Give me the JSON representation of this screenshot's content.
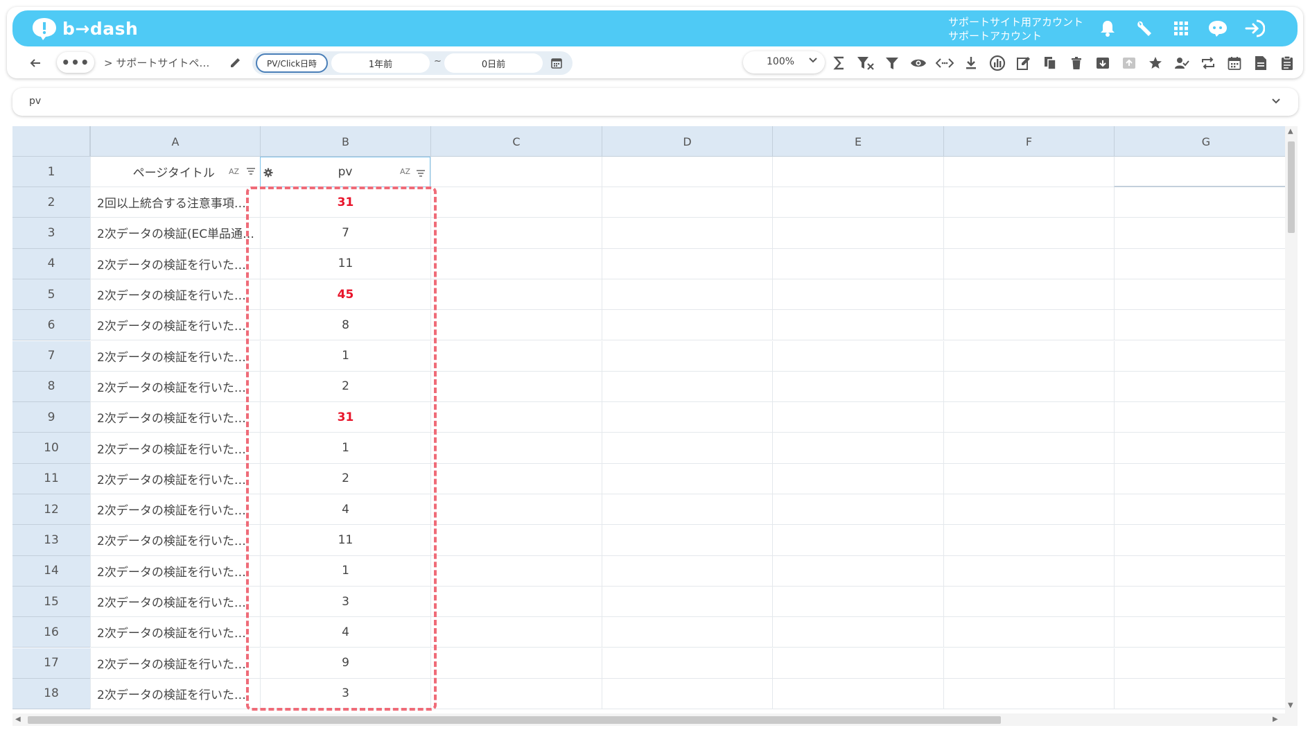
{
  "app": {
    "logo_text": "b→dash",
    "account_line1": "サポートサイト用アカウント",
    "account_line2": "サポートアカウント"
  },
  "top_icons": [
    "bell-icon",
    "wrench-icon",
    "grid-icon",
    "chat-icon",
    "logout-icon"
  ],
  "toolbar": {
    "breadcrumb": "> サポートサイトペ…",
    "date_type": "PV/Click日時",
    "date_from": "1年前",
    "date_separator": "~",
    "date_to": "0日前",
    "zoom": "100%",
    "tool_icons": [
      "sigma-icon",
      "filter-remove-icon",
      "filter-icon",
      "eye-icon",
      "code-icon",
      "download-icon",
      "chart-icon",
      "edit-note-icon",
      "copy-icon",
      "trash-icon",
      "archive-icon",
      "archive-disabled-icon",
      "star-icon",
      "user-check-icon",
      "repeat-icon",
      "calendar-icon",
      "document-icon",
      "clipboard-icon"
    ]
  },
  "formula_bar": {
    "value": "pv"
  },
  "grid": {
    "columns": [
      "A",
      "B",
      "C",
      "D",
      "E",
      "F",
      "G"
    ],
    "header_row": {
      "number": "1",
      "col_a": "ページタイトル",
      "col_b": "pv",
      "sort_label": "AZ"
    },
    "rows": [
      {
        "num": "2",
        "a": "2回以上統合する注意事項…",
        "b": "31",
        "hl": true
      },
      {
        "num": "3",
        "a": "2次データの検証(EC単品通…",
        "b": "7",
        "hl": false
      },
      {
        "num": "4",
        "a": "2次データの検証を行いた…",
        "b": "11",
        "hl": false
      },
      {
        "num": "5",
        "a": "2次データの検証を行いた…",
        "b": "45",
        "hl": true
      },
      {
        "num": "6",
        "a": "2次データの検証を行いた…",
        "b": "8",
        "hl": false
      },
      {
        "num": "7",
        "a": "2次データの検証を行いた…",
        "b": "1",
        "hl": false
      },
      {
        "num": "8",
        "a": "2次データの検証を行いた…",
        "b": "2",
        "hl": false
      },
      {
        "num": "9",
        "a": "2次データの検証を行いた…",
        "b": "31",
        "hl": true
      },
      {
        "num": "10",
        "a": "2次データの検証を行いた…",
        "b": "1",
        "hl": false
      },
      {
        "num": "11",
        "a": "2次データの検証を行いた…",
        "b": "2",
        "hl": false
      },
      {
        "num": "12",
        "a": "2次データの検証を行いた…",
        "b": "4",
        "hl": false
      },
      {
        "num": "13",
        "a": "2次データの検証を行いた…",
        "b": "11",
        "hl": false
      },
      {
        "num": "14",
        "a": "2次データの検証を行いた…",
        "b": "1",
        "hl": false
      },
      {
        "num": "15",
        "a": "2次データの検証を行いた…",
        "b": "3",
        "hl": false
      },
      {
        "num": "16",
        "a": "2次データの検証を行いた…",
        "b": "4",
        "hl": false
      },
      {
        "num": "17",
        "a": "2次データの検証を行いた…",
        "b": "9",
        "hl": false
      },
      {
        "num": "18",
        "a": "2次データの検証を行いた…",
        "b": "3",
        "hl": false
      }
    ]
  },
  "colors": {
    "brand": "#4fcaf5",
    "highlight": "#e8152b",
    "selection_dash": "#ef6b78",
    "header_bg": "#dce8f4"
  }
}
